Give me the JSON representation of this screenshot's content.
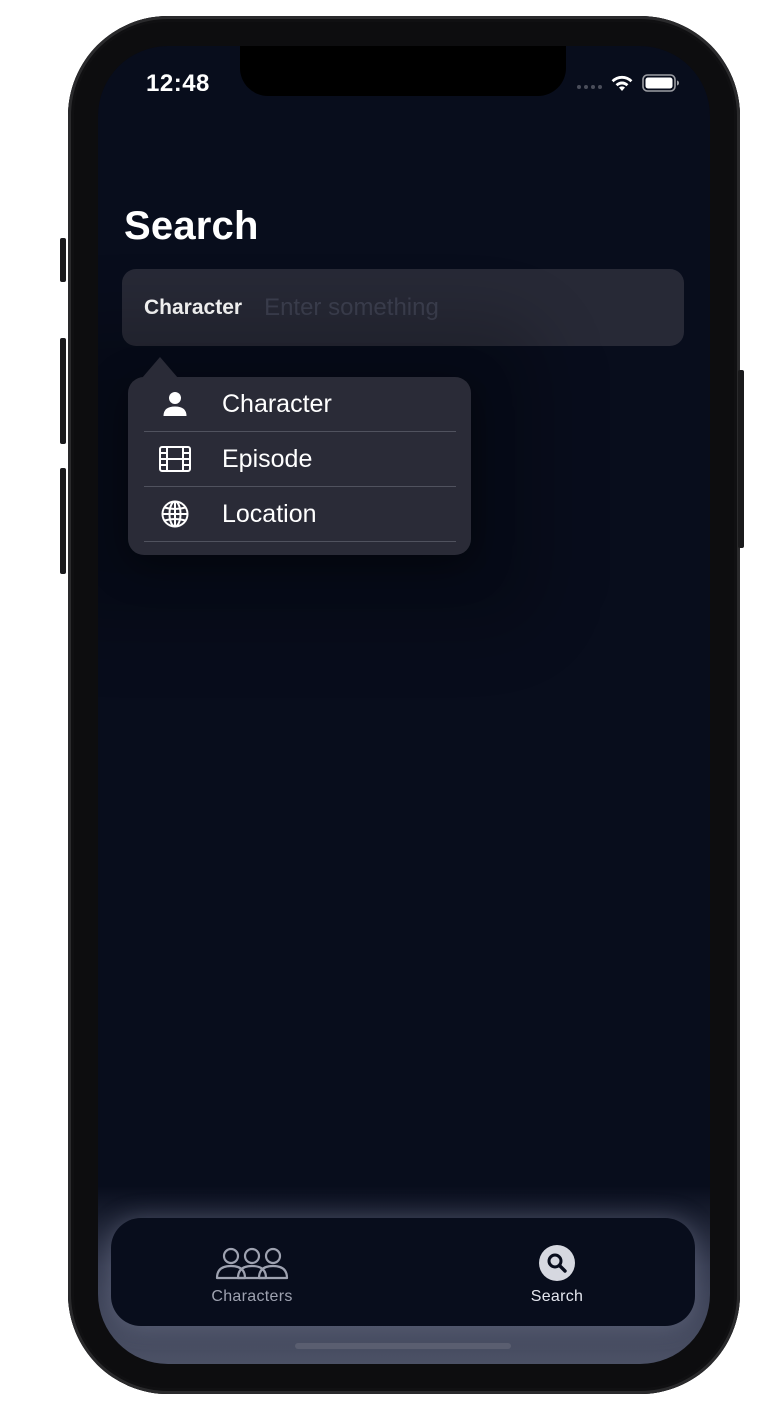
{
  "status_bar": {
    "time": "12:48"
  },
  "page": {
    "title": "Search"
  },
  "search": {
    "type_label": "Character",
    "placeholder": "Enter something",
    "value": ""
  },
  "menu": {
    "items": [
      {
        "label": "Character",
        "icon": "person-icon"
      },
      {
        "label": "Episode",
        "icon": "film-icon"
      },
      {
        "label": "Location",
        "icon": "globe-icon"
      }
    ]
  },
  "tab_bar": {
    "tabs": [
      {
        "label": "Characters",
        "icon": "people-icon",
        "active": false
      },
      {
        "label": "Search",
        "icon": "search-icon",
        "active": true
      }
    ]
  },
  "colors": {
    "background": "#080d1c",
    "surface": "#272936",
    "menu_surface": "#2a2b37",
    "text_primary": "#ffffff",
    "placeholder": "#3d4050",
    "tab_inactive": "#9ea2b0"
  }
}
